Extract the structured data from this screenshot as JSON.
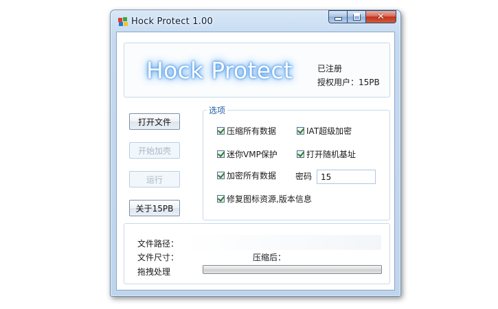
{
  "window": {
    "title": "Hock Protect 1.00"
  },
  "banner": {
    "logo": "Hock Protect",
    "registration_status": "已注册",
    "licensed_user": "授权用户：15PB"
  },
  "buttons": {
    "open_file": "打开文件",
    "start_pack": "开始加壳",
    "run": "运行",
    "about": "关于15PB"
  },
  "options": {
    "legend": "选项",
    "compress_all": "压缩所有数据",
    "iat_encrypt": "IAT超级加密",
    "mini_vmp": "迷你VMP保护",
    "random_base": "打开随机基址",
    "encrypt_all": "加密所有数据",
    "password_label": "密码",
    "password_value": "15",
    "fix_resources": "修复图标资源,版本信息"
  },
  "info": {
    "file_path_label": "文件路径：",
    "file_size_label": "文件尺寸：",
    "compressed_label": "压缩后：",
    "drag_label": "拖拽处理",
    "progress": 0
  },
  "icons": {
    "app": "app-icon",
    "minimize": "minimize-icon",
    "maximize": "maximize-icon",
    "close": "close-icon",
    "check": "checkmark-icon"
  },
  "colors": {
    "close_button": "#c1321d",
    "legend_text": "#1f5fa5",
    "logo_glow": "#4f9ae8",
    "checkmark": "#2c7a24"
  }
}
